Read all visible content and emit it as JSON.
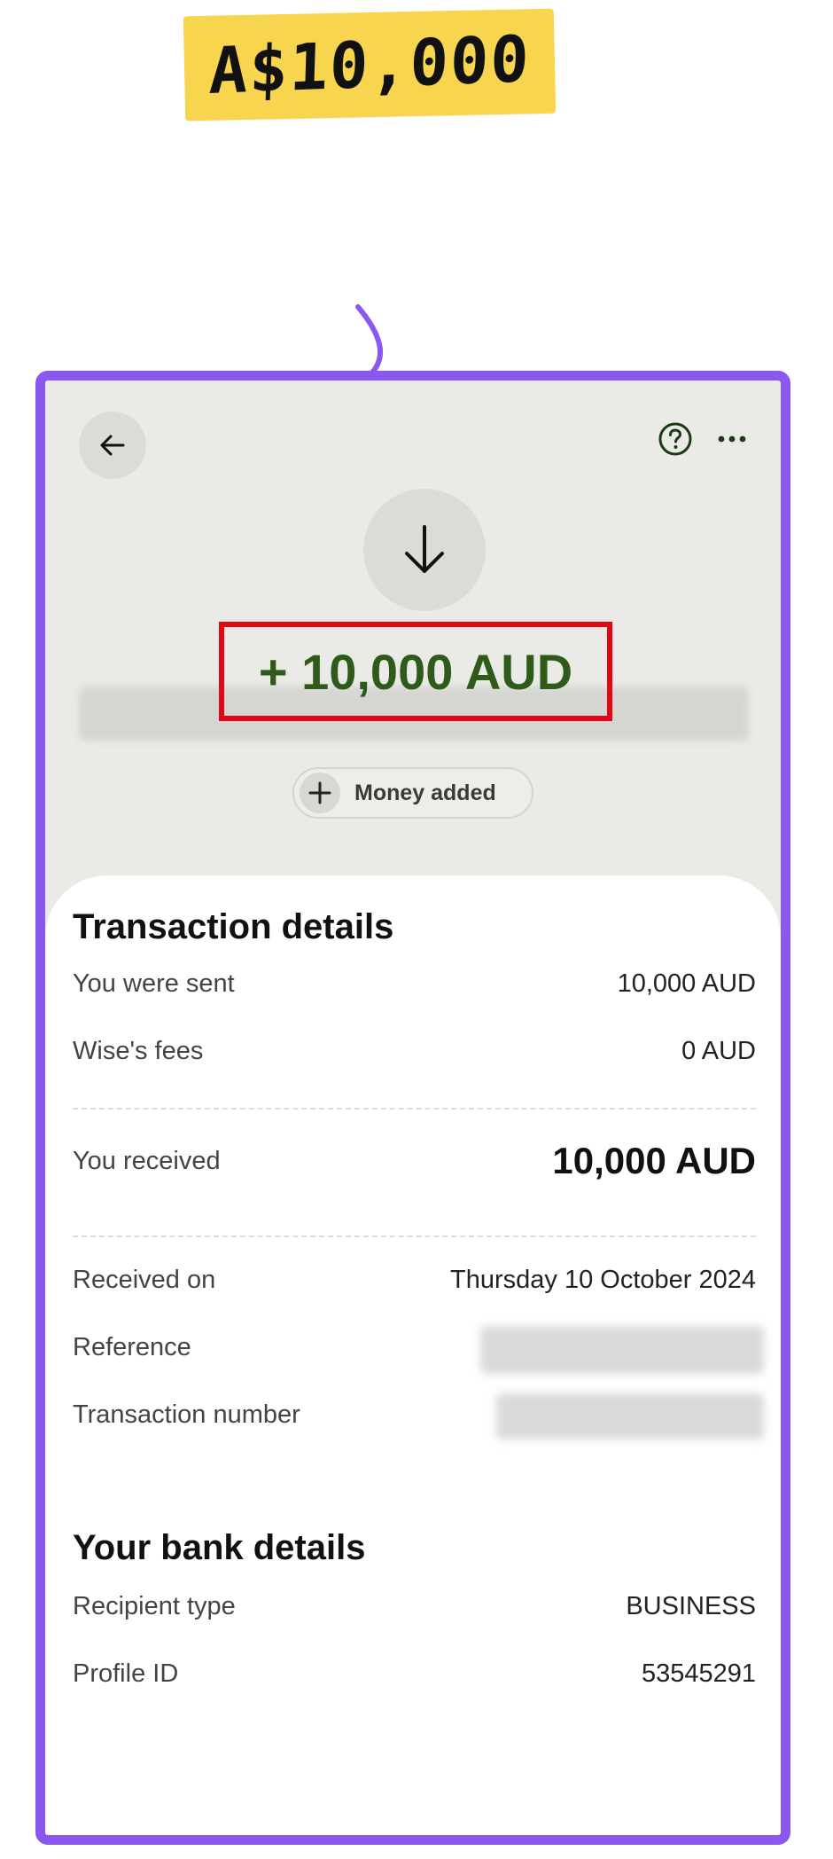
{
  "annotation": {
    "sticker_text": "A$10,000",
    "sticker_color": "#f7d54f",
    "arrow_color": "#8a57ef",
    "frame_color": "#8a57ef",
    "highlight_color": "#e30613"
  },
  "topbar": {
    "back_icon": "arrow-left-icon",
    "help_icon": "question-circle-icon",
    "more_icon": "more-horizontal-icon"
  },
  "hero": {
    "icon": "arrow-down-icon",
    "amount": "+ 10,000 AUD",
    "amount_color": "#2f5b1a",
    "status_chip": "Money added",
    "status_icon": "plus-icon"
  },
  "transaction_details": {
    "title": "Transaction details",
    "rows": [
      {
        "label": "You were sent",
        "value": "10,000 AUD"
      },
      {
        "label": "Wise's fees",
        "value": "0 AUD"
      }
    ],
    "received": {
      "label": "You received",
      "value": "10,000 AUD"
    },
    "meta": [
      {
        "label": "Received on",
        "value": "Thursday 10 October 2024"
      },
      {
        "label": "Reference",
        "value": ""
      },
      {
        "label": "Transaction number",
        "value": ""
      }
    ]
  },
  "bank_details": {
    "title": "Your bank details",
    "rows": [
      {
        "label": "Recipient type",
        "value": "BUSINESS"
      },
      {
        "label": "Profile ID",
        "value": "53545291"
      }
    ]
  }
}
